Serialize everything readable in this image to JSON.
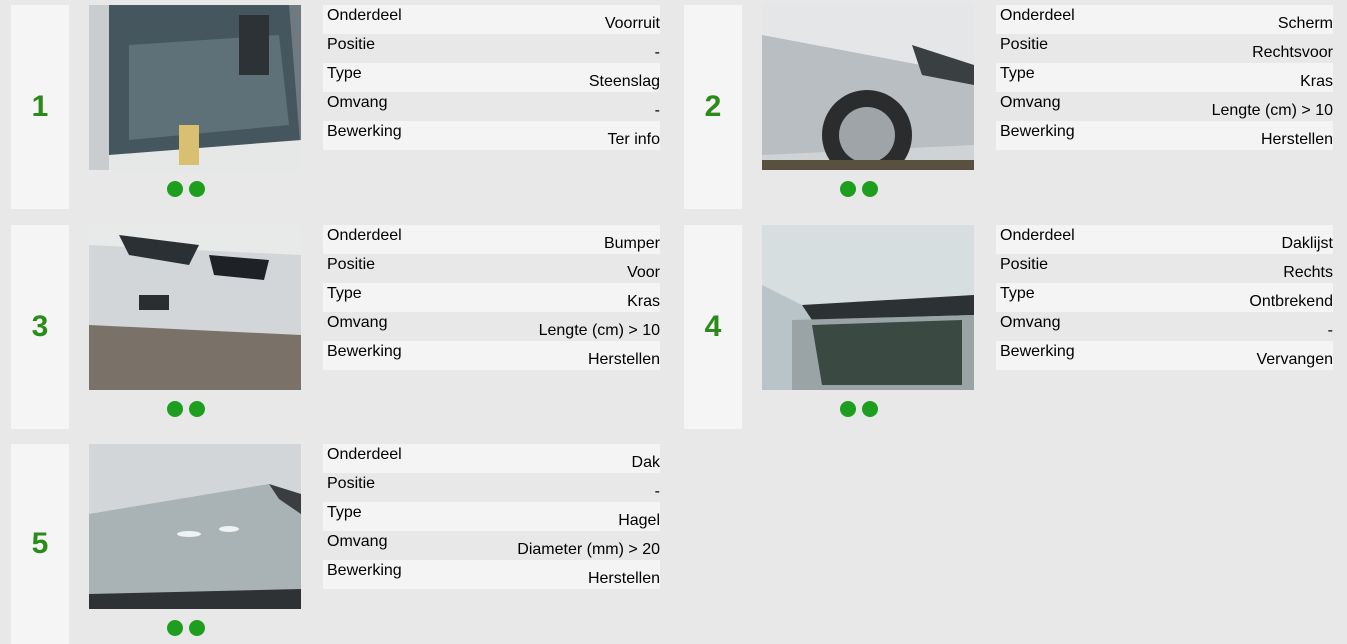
{
  "items": [
    {
      "number": "1",
      "rows": [
        {
          "label": "Onderdeel",
          "value": "Voorruit"
        },
        {
          "label": "Positie",
          "value": "-"
        },
        {
          "label": "Type",
          "value": "Steenslag"
        },
        {
          "label": "Omvang",
          "value": "-"
        },
        {
          "label": "Bewerking",
          "value": "Ter info"
        }
      ]
    },
    {
      "number": "2",
      "rows": [
        {
          "label": "Onderdeel",
          "value": "Scherm"
        },
        {
          "label": "Positie",
          "value": "Rechtsvoor"
        },
        {
          "label": "Type",
          "value": "Kras"
        },
        {
          "label": "Omvang",
          "value": "Lengte (cm) > 10"
        },
        {
          "label": "Bewerking",
          "value": "Herstellen"
        }
      ]
    },
    {
      "number": "3",
      "rows": [
        {
          "label": "Onderdeel",
          "value": "Bumper"
        },
        {
          "label": "Positie",
          "value": "Voor"
        },
        {
          "label": "Type",
          "value": "Kras"
        },
        {
          "label": "Omvang",
          "value": "Lengte (cm) > 10"
        },
        {
          "label": "Bewerking",
          "value": "Herstellen"
        }
      ]
    },
    {
      "number": "4",
      "rows": [
        {
          "label": "Onderdeel",
          "value": "Daklijst"
        },
        {
          "label": "Positie",
          "value": "Rechts"
        },
        {
          "label": "Type",
          "value": "Ontbrekend"
        },
        {
          "label": "Omvang",
          "value": "-"
        },
        {
          "label": "Bewerking",
          "value": "Vervangen"
        }
      ]
    },
    {
      "number": "5",
      "rows": [
        {
          "label": "Onderdeel",
          "value": "Dak"
        },
        {
          "label": "Positie",
          "value": "-"
        },
        {
          "label": "Type",
          "value": "Hagel"
        },
        {
          "label": "Omvang",
          "value": "Diameter (mm) > 20"
        },
        {
          "label": "Bewerking",
          "value": "Herstellen"
        }
      ]
    }
  ],
  "colors": {
    "number": "#2a8a1a",
    "dot": "#1e9e1e"
  }
}
